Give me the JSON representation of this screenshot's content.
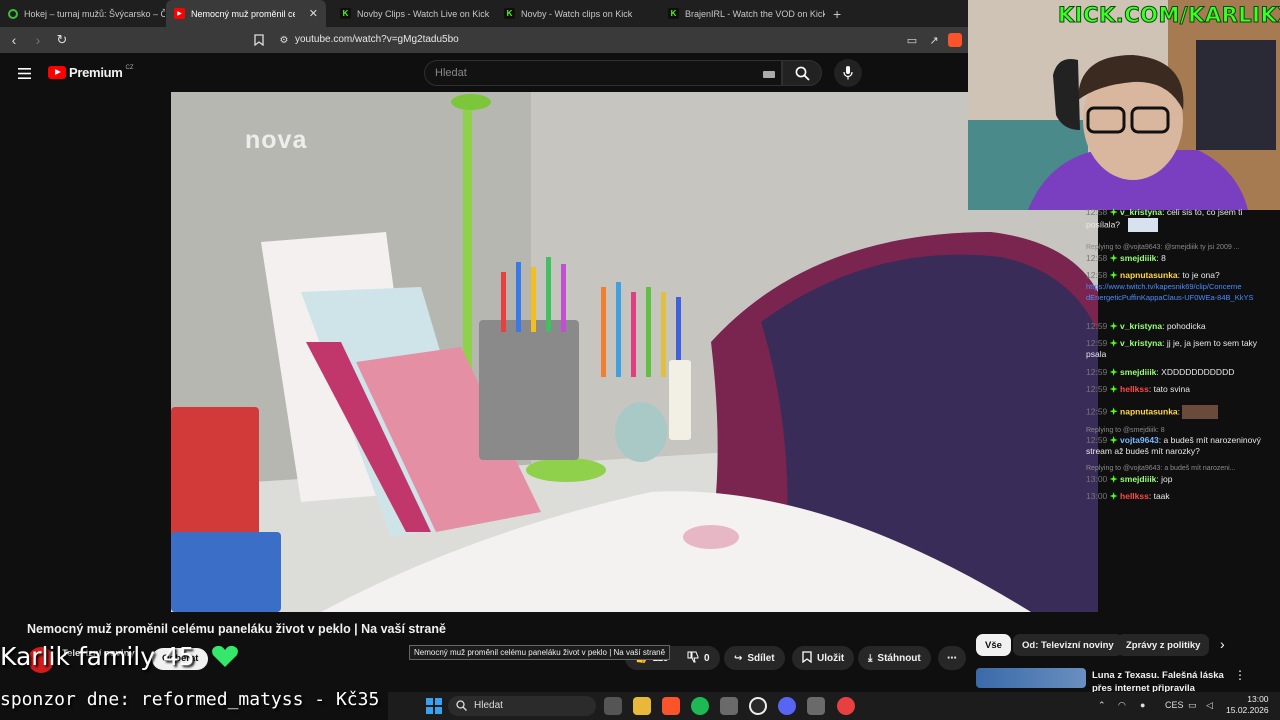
{
  "browser": {
    "tabs": [
      {
        "title": "Hokej – turnaj mužů: Švýcarsko – Če...",
        "favicon": "ct-sport-icon",
        "active": false
      },
      {
        "title": "Nemocný muž proměnil celé",
        "favicon": "youtube-icon",
        "active": true
      },
      {
        "title": "Novby Clips - Watch Live on Kick",
        "favicon": "kick-icon",
        "active": false
      },
      {
        "title": "Novby - Watch clips on Kick",
        "favicon": "kick-icon",
        "active": false
      },
      {
        "title": "BrajenIRL - Watch the VOD on Kick",
        "favicon": "kick-icon",
        "active": false
      }
    ],
    "url": "youtube.com/watch?v=gMg2tadu5bo"
  },
  "youtube": {
    "logo_text": "Premium",
    "region": "CZ",
    "search_placeholder": "Hledat",
    "video_title": "Nemocný muž proměnil celému paneláku život v peklo | Na vaší straně",
    "watermark": "nova",
    "channel_name": "Televizní noviny",
    "subscribe_label": "Odběrat",
    "like_count": "119",
    "dislike_count": "0",
    "share_label": "Sdílet",
    "save_label": "Uložit",
    "download_label": "Stáhnout",
    "tooltip": "Nemocný muž proměnil celému paneláku život v peklo | Na vaší straně",
    "chips": [
      "Vše",
      "Od: Televizní noviny",
      "Zprávy z politiky"
    ],
    "related_title_1": "Luna z Texasu. Falešná láska",
    "related_title_2": "přes internet připravila"
  },
  "stream": {
    "kick_url": "KICK.COM/KARLIKXD",
    "overlay_family": "Karlik family 45",
    "overlay_sponsor": "sponzor dne: reformed_matyss - Kč35"
  },
  "chat": [
    {
      "time": "12:58",
      "user": "v_kristyna",
      "color": "#9aff7a",
      "text": "celi sis to, co jsem ti",
      "cont": "posílala?"
    },
    {
      "reply": "Replying to @vojta9643: @smejdiiik ty jsi 2009 ..."
    },
    {
      "time": "12:58",
      "user": "smejdiiik",
      "color": "#9aff7a",
      "text": "8"
    },
    {
      "time": "12:58",
      "user": "napnutasunka",
      "color": "#ffd84a",
      "text": "to je ona?"
    },
    {
      "link": "https://www.twitch.tv/kapesnik69/clip/Concerne",
      "link2": "dEnergeticPuffinKappaClaus-UF0WEa-84B_KkYS"
    },
    {
      "time": "12:59",
      "user": "v_kristyna",
      "color": "#9aff7a",
      "text": "pohodicka"
    },
    {
      "time": "12:59",
      "user": "v_kristyna",
      "color": "#9aff7a",
      "text": "jj je, ja jsem to sem taky",
      "cont": "psala"
    },
    {
      "time": "12:59",
      "user": "smejdiiik",
      "color": "#9aff7a",
      "text": "XDDDDDDDDDDD"
    },
    {
      "time": "12:59",
      "user": "hellkss",
      "color": "#ff4a4a",
      "text": "tato svina"
    },
    {
      "time": "12:59",
      "user": "napnutasunka",
      "color": "#ffd84a",
      "text": ""
    },
    {
      "reply": "Replying to @smejdiiik: 8"
    },
    {
      "time": "12:59",
      "user": "vojta9643",
      "color": "#7ab8ff",
      "text": "a budeš mít narozeninový",
      "cont": "stream až budeš mít narozky?"
    },
    {
      "reply": "Replying to @vojta9643: a budeš mít narozeni..."
    },
    {
      "time": "13:00",
      "user": "smejdiiik",
      "color": "#9aff7a",
      "text": "jop"
    },
    {
      "time": "13:00",
      "user": "hellkss",
      "color": "#ff4a4a",
      "text": "taak"
    }
  ],
  "taskbar": {
    "search_placeholder": "Hledat",
    "language": "CES",
    "time": "13:00",
    "date": "15.02.2026"
  }
}
